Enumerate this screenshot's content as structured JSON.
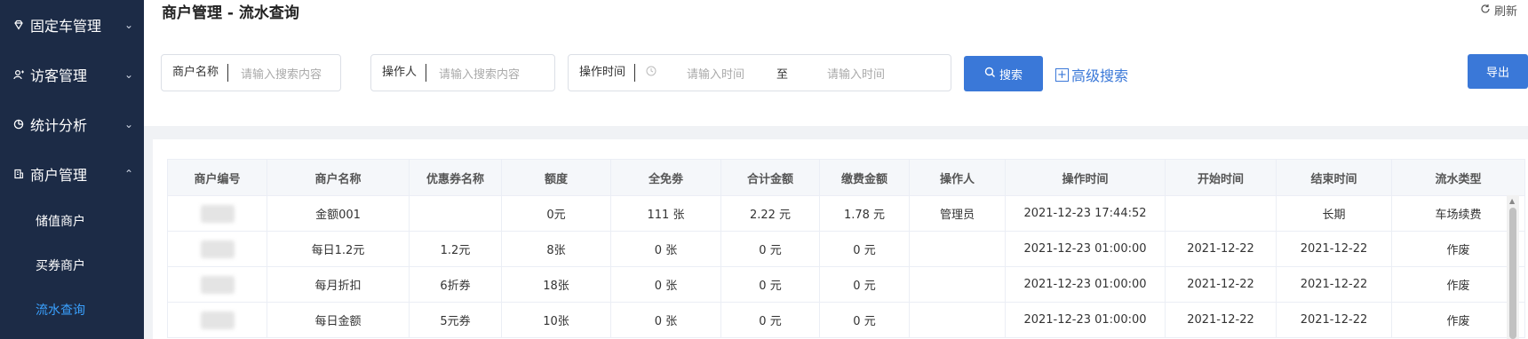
{
  "sidebar": {
    "items": [
      {
        "label": "固定车管理",
        "icon": "diamond-icon",
        "chevron": "⌄"
      },
      {
        "label": "访客管理",
        "icon": "user-plus-icon",
        "chevron": "⌄"
      },
      {
        "label": "统计分析",
        "icon": "pie-chart-icon",
        "chevron": "⌄"
      },
      {
        "label": "商户管理",
        "icon": "building-icon",
        "chevron": "⌃"
      }
    ],
    "sub_items": [
      {
        "label": "储值商户"
      },
      {
        "label": "买券商户"
      },
      {
        "label": "流水查询",
        "active": true
      }
    ]
  },
  "header": {
    "title": "商户管理 - 流水查询",
    "refresh_label": "刷新"
  },
  "filters": {
    "merchant_name": {
      "label": "商户名称",
      "placeholder": "请输入搜索内容"
    },
    "operator": {
      "label": "操作人",
      "placeholder": "请输入搜索内容"
    },
    "op_time": {
      "label": "操作时间",
      "start_placeholder": "请输入时间",
      "separator": "至",
      "end_placeholder": "请输入时间"
    },
    "search_label": "搜索",
    "advanced_label": "高级搜索",
    "export_label": "导出"
  },
  "colors": {
    "sidebar_bg": "#1c2b46",
    "accent": "#3a78d8",
    "active_text": "#3aa1ff"
  },
  "table": {
    "columns": [
      "商户编号",
      "商户名称",
      "优惠券名称",
      "额度",
      "全免劵",
      "合计金额",
      "缴费金额",
      "操作人",
      "操作时间",
      "开始时间",
      "结束时间",
      "流水类型"
    ],
    "rows": [
      {
        "name": "金额001",
        "coupon": "",
        "quota": "0元",
        "free": "111 张",
        "total": "2.22 元",
        "paid": "1.78 元",
        "operator": "管理员",
        "op_time": "2021-12-23 17:44:52",
        "start": "",
        "end": "长期",
        "type": "车场续费"
      },
      {
        "name": "每日1.2元",
        "coupon": "1.2元",
        "quota": "8张",
        "free": "0 张",
        "total": "0 元",
        "paid": "0 元",
        "operator": "",
        "op_time": "2021-12-23 01:00:00",
        "start": "2021-12-22",
        "end": "2021-12-22",
        "type": "作废"
      },
      {
        "name": "每月折扣",
        "coupon": "6折券",
        "quota": "18张",
        "free": "0 张",
        "total": "0 元",
        "paid": "0 元",
        "operator": "",
        "op_time": "2021-12-23 01:00:00",
        "start": "2021-12-22",
        "end": "2021-12-22",
        "type": "作废"
      },
      {
        "name": "每日金额",
        "coupon": "5元券",
        "quota": "10张",
        "free": "0 张",
        "total": "0 元",
        "paid": "0 元",
        "operator": "",
        "op_time": "2021-12-23 01:00:00",
        "start": "2021-12-22",
        "end": "2021-12-22",
        "type": "作废"
      }
    ]
  }
}
